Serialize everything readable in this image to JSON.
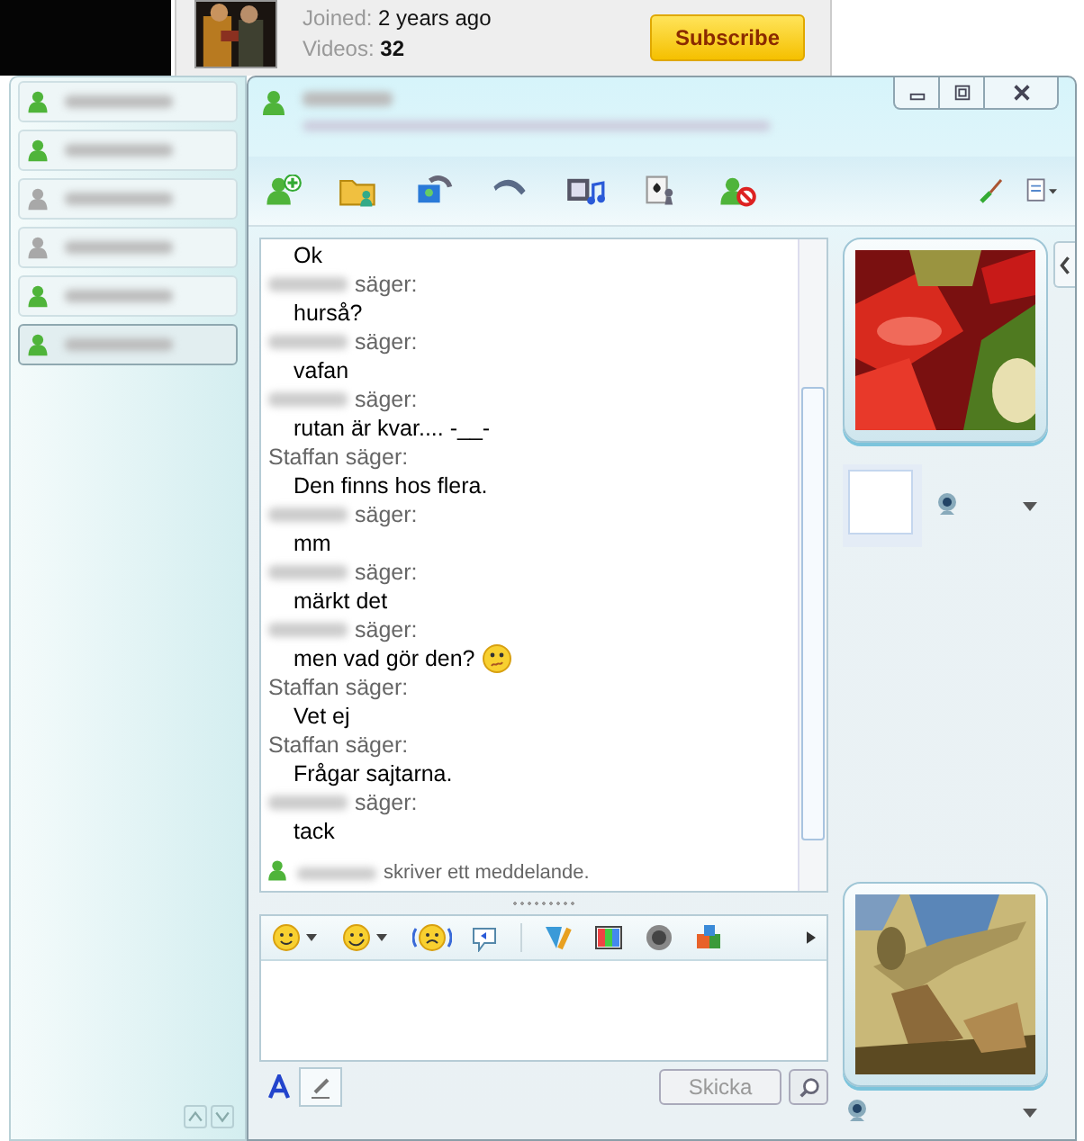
{
  "channel": {
    "joined_label": "Joined:",
    "joined": "2 years ago",
    "videos_label": "Videos:",
    "videos": "32",
    "subscribe": "Subscribe"
  },
  "contacts": [
    {
      "online": true,
      "selected": false
    },
    {
      "online": true,
      "selected": false
    },
    {
      "online": false,
      "selected": false
    },
    {
      "online": false,
      "selected": false
    },
    {
      "online": true,
      "selected": false
    },
    {
      "online": true,
      "selected": true
    }
  ],
  "conversation": {
    "messages": [
      {
        "kind": "continued",
        "text": "Ok"
      },
      {
        "kind": "hidden",
        "said": "säger:",
        "text": "hurså?"
      },
      {
        "kind": "hidden",
        "said": "säger:",
        "text": "vafan"
      },
      {
        "kind": "hidden",
        "said": "säger:",
        "text": "rutan är kvar.... -__-"
      },
      {
        "kind": "named",
        "sender": "Staffan säger:",
        "text": "Den finns hos flera."
      },
      {
        "kind": "hidden",
        "said": "säger:",
        "text": "mm"
      },
      {
        "kind": "hidden",
        "said": "säger:",
        "text": "märkt det"
      },
      {
        "kind": "hidden",
        "said": "säger:",
        "text": "men vad gör den?",
        "emoticon": true
      },
      {
        "kind": "named",
        "sender": "Staffan säger:",
        "text": "Vet ej"
      },
      {
        "kind": "named",
        "sender": "Staffan säger:",
        "text": "Frågar sajtarna."
      },
      {
        "kind": "hidden",
        "said": "säger:",
        "text": "tack"
      }
    ],
    "typing": "skriver ett meddelande.",
    "send_button": {
      "label": "Skicka",
      "disabled": true
    }
  }
}
